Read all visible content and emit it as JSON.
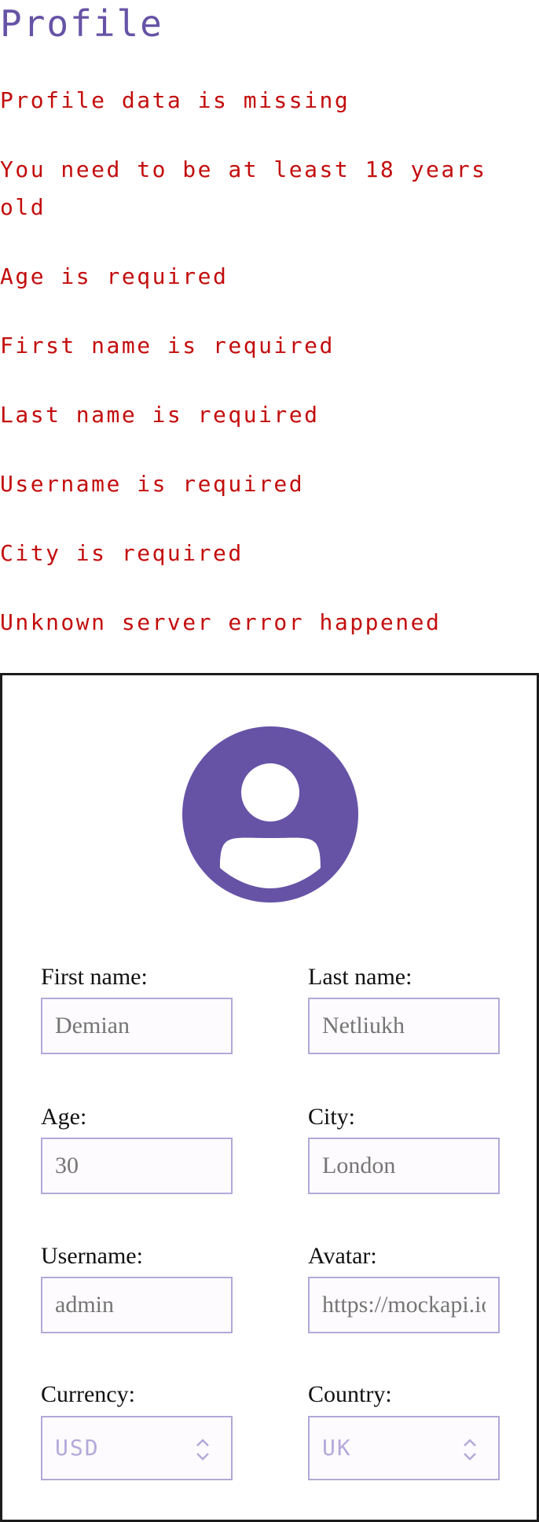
{
  "page": {
    "title": "Profile"
  },
  "errors": [
    "Profile data is missing",
    "You need to be at least 18 years old",
    "Age is required",
    "First name is required",
    "Last name is required",
    "Username is required",
    "City is required",
    "Unknown server error happened"
  ],
  "form": {
    "first_name": {
      "label": "First name:",
      "placeholder": "Demian"
    },
    "last_name": {
      "label": "Last name:",
      "placeholder": "Netliukh"
    },
    "age": {
      "label": "Age:",
      "placeholder": "30"
    },
    "city": {
      "label": "City:",
      "placeholder": "London"
    },
    "username": {
      "label": "Username:",
      "placeholder": "admin"
    },
    "avatar": {
      "label": "Avatar:",
      "placeholder": "https://mockapi.io/avatar.png"
    },
    "currency": {
      "label": "Currency:",
      "value": "USD"
    },
    "country": {
      "label": "Country:",
      "value": "UK"
    }
  },
  "icons": {
    "avatar": "user-avatar-icon",
    "select_chevron": "chevron-up-down-icon"
  },
  "colors": {
    "accent": "#6653a6",
    "error": "#c30d0d",
    "input_border": "#b3a9d8",
    "placeholder": "#b5a9da"
  }
}
